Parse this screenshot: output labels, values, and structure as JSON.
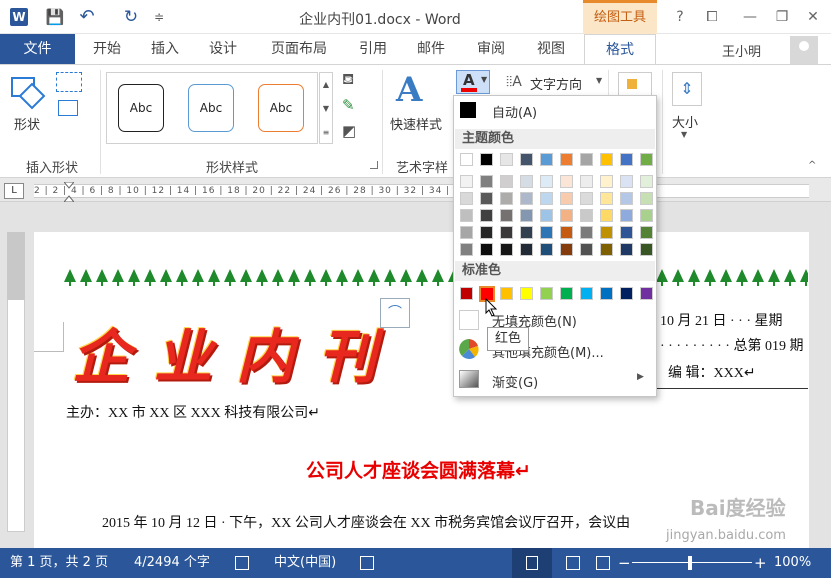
{
  "title_bar": {
    "app_logo": "W",
    "document_title": "企业内刊01.docx - Word",
    "contextual_tab_group": "绘图工具",
    "help_glyph": "?",
    "save_glyph": "💾",
    "undo_glyph": "↶",
    "redo_glyph": "↻",
    "customize_glyph": "≑",
    "restore_glyph": "⧠",
    "minimize_glyph": "—",
    "maximize_glyph": "❐",
    "close_glyph": "✕"
  },
  "tabs": {
    "file": "文件",
    "items": [
      "开始",
      "插入",
      "设计",
      "页面布局",
      "引用",
      "邮件",
      "审阅",
      "视图",
      "格式"
    ],
    "user_name": "王小明"
  },
  "ribbon": {
    "insert_shapes": {
      "shapes_label": "形状",
      "group_label": "插入形状"
    },
    "shape_styles": {
      "preset_label": "Abc",
      "group_label": "形状样式",
      "presets": [
        "Abc",
        "Abc",
        "Abc"
      ]
    },
    "wordart": {
      "quick_styles_label": "快速样式",
      "group_label": "艺术字样"
    },
    "text": {
      "text_direction_label": "文字方向"
    },
    "size": {
      "label": "大小"
    }
  },
  "ruler": {
    "corner": "L",
    "marks": "2 | 2 | 4 | 6 | 8 | 10 | 12 | 14 | 16 | 18 | 20 | 22 | 24 | 26 | 28 | 30 | 32 | 34 | 36 | 38 | 40 | 42 | 44 | 46 | 48 |"
  },
  "document": {
    "masthead": "企业内刊",
    "publisher_line": "主办：XX 市 XX 区 XXX 科技有限公司↵",
    "date_line": "10 月 21 日 · · · 星期",
    "issue_line": "· · · · · · · · · 总第 019 期",
    "editor_line": "编  辑：XXX↵",
    "headline": "公司人才座谈会圆满落幕↵",
    "body_line": "2015 年 10 月 12 日 · 下午，XX 公司人才座谈会在 XX 市税务宾馆会议厅召开，会议由"
  },
  "font_color_menu": {
    "automatic": "自动(A)",
    "theme_colors_header": "主题颜色",
    "standard_colors_header": "标准色",
    "no_fill": "无填充颜色(N)",
    "more_colors": "其他填充颜色(M)...",
    "gradient": "渐变(G)",
    "tooltip": "红色",
    "theme_top_row": [
      "#ffffff",
      "#000000",
      "#e7e6e6",
      "#44546a",
      "#5b9bd5",
      "#ed7d31",
      "#a5a5a5",
      "#ffc000",
      "#4472c4",
      "#70ad47"
    ],
    "theme_shades": [
      [
        "#f2f2f2",
        "#7f7f7f",
        "#d0cece",
        "#d6dce4",
        "#ddebf7",
        "#fbe5d6",
        "#ededed",
        "#fff2cc",
        "#dae3f3",
        "#e2efda"
      ],
      [
        "#d9d9d9",
        "#595959",
        "#aeabab",
        "#adb9ca",
        "#bdd7ee",
        "#f8cbad",
        "#dbdbdb",
        "#ffe699",
        "#b4c7e7",
        "#c6e0b4"
      ],
      [
        "#bfbfbf",
        "#404040",
        "#757171",
        "#8497b0",
        "#9dc3e6",
        "#f4b183",
        "#c9c9c9",
        "#ffd966",
        "#8faadc",
        "#a9d18e"
      ],
      [
        "#a6a6a6",
        "#262626",
        "#3a3838",
        "#323f4f",
        "#2e75b6",
        "#c55a11",
        "#7b7b7b",
        "#bf9000",
        "#2f5597",
        "#548235"
      ],
      [
        "#808080",
        "#0d0d0d",
        "#171616",
        "#222a35",
        "#1f4e79",
        "#843c0c",
        "#525252",
        "#7f6000",
        "#203864",
        "#375623"
      ]
    ],
    "standard_colors": [
      "#c00000",
      "#ff0000",
      "#ffc000",
      "#ffff00",
      "#92d050",
      "#00b050",
      "#00b0f0",
      "#0070c0",
      "#002060",
      "#7030a0"
    ]
  },
  "status_bar": {
    "page": "第 1 页，共 2 页",
    "words": "4/2494 个字",
    "language": "中文(中国)",
    "zoom": "100%",
    "zoom_minus": "−",
    "zoom_plus": "+"
  },
  "watermark": {
    "text": "Bai度经验",
    "url": "jingyan.baidu.com"
  },
  "colors": {
    "brand": "#2b579a",
    "accent_orange": "#e78a2b",
    "headline_red": "#e80000"
  }
}
